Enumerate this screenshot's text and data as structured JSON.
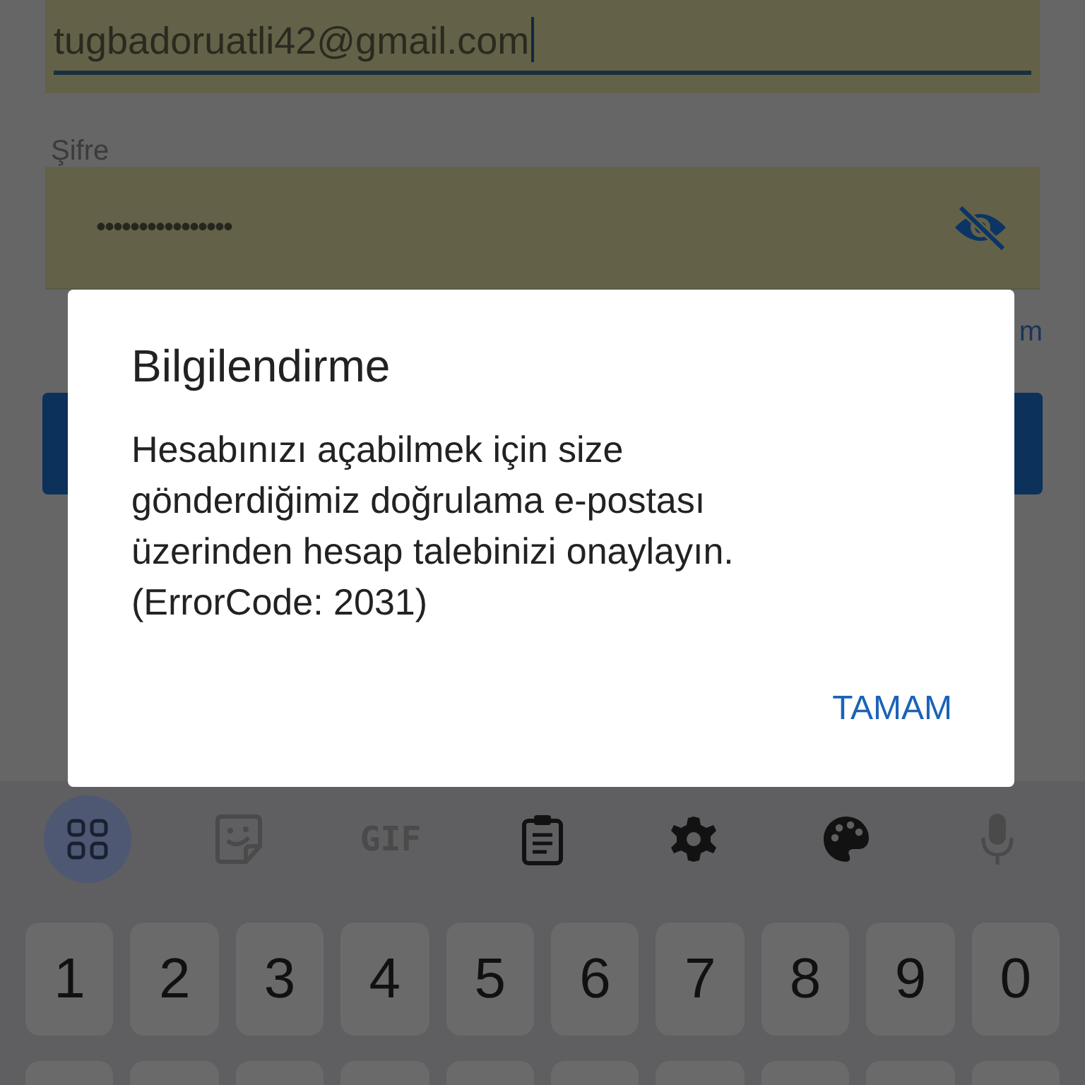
{
  "email_field": {
    "value": "tugbadoruatli42@gmail.com",
    "focused": true
  },
  "password_field": {
    "label": "Şifre",
    "value": "••••••••••••••••",
    "visible": false
  },
  "partial_link": "m",
  "dialog": {
    "title": "Bilgilendirme",
    "message": "Hesabınızı açabilmek için size gönderdiğimiz doğrulama e-postası üzerinden hesap talebinizi onaylayın.\n(ErrorCode: 2031)",
    "button": "TAMAM"
  },
  "keyboard": {
    "toolbar": [
      {
        "kind": "apps",
        "selected": true,
        "disabled": false
      },
      {
        "kind": "sticker",
        "selected": false,
        "disabled": true
      },
      {
        "kind": "gif",
        "label": "GIF",
        "selected": false,
        "disabled": true
      },
      {
        "kind": "clipboard",
        "selected": false,
        "disabled": false
      },
      {
        "kind": "settings",
        "selected": false,
        "disabled": false
      },
      {
        "kind": "theme",
        "selected": false,
        "disabled": false
      },
      {
        "kind": "mic",
        "selected": false,
        "disabled": true
      }
    ],
    "number_keys": [
      "1",
      "2",
      "3",
      "4",
      "5",
      "6",
      "7",
      "8",
      "9",
      "0"
    ]
  }
}
